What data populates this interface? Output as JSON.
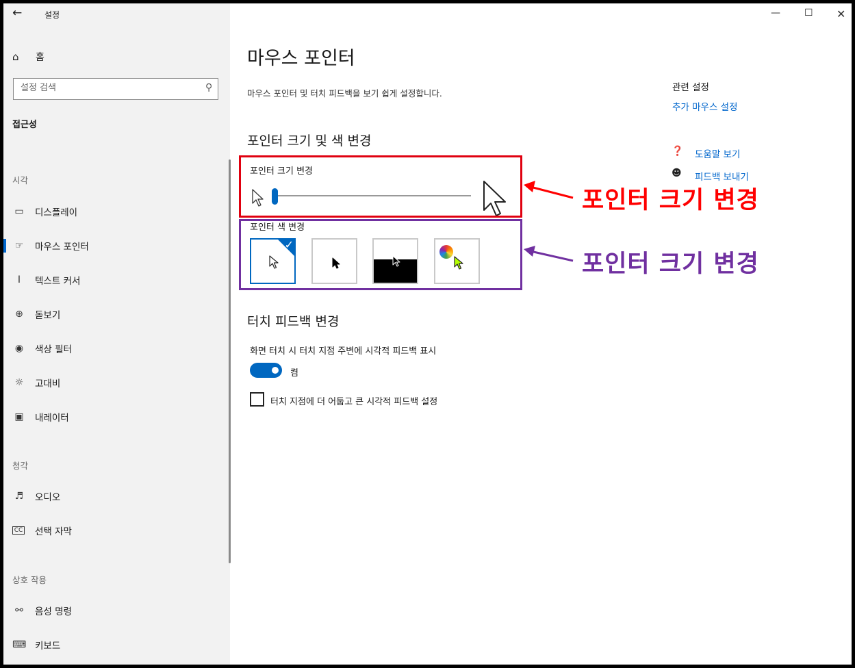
{
  "window": {
    "title": "설정",
    "back_icon": "back-arrow-icon"
  },
  "sidebar": {
    "home_label": "홈",
    "search_placeholder": "설정 검색",
    "section_title": "접근성",
    "categories": {
      "vision": "시각",
      "hearing": "청각",
      "interaction": "상호 작용"
    },
    "items": [
      {
        "label": "디스플레이",
        "icon": "display-icon"
      },
      {
        "label": "마우스 포인터",
        "icon": "mouse-pointer-icon",
        "active": true
      },
      {
        "label": "텍스트 커서",
        "icon": "text-cursor-icon"
      },
      {
        "label": "돋보기",
        "icon": "magnifier-icon"
      },
      {
        "label": "색상 필터",
        "icon": "palette-icon"
      },
      {
        "label": "고대비",
        "icon": "sun-icon"
      },
      {
        "label": "내레이터",
        "icon": "narrator-icon"
      },
      {
        "label": "오디오",
        "icon": "speaker-icon"
      },
      {
        "label": "선택 자막",
        "icon": "cc-icon"
      },
      {
        "label": "음성 명령",
        "icon": "microphone-icon"
      },
      {
        "label": "키보드",
        "icon": "keyboard-icon"
      }
    ]
  },
  "main": {
    "title": "마우스 포인터",
    "description": "마우스 포인터 및 터치 피드백을 보기 쉽게 설정합니다.",
    "section_pointer": "포인터 크기 및 색 변경",
    "size_label": "포인터 크기 변경",
    "size_slider_fraction": 0.02,
    "color_label": "포인터 색 변경",
    "color_options": [
      "white",
      "black",
      "inverted",
      "custom"
    ],
    "color_selected_index": 0,
    "section_touch": "터치 피드백 변경",
    "touch_label": "화면 터치 시 터치 지점 주변에 시각적 피드백 표시",
    "touch_toggle_state": "켬",
    "touch_toggle_on": true,
    "darker_feedback_label": "터치 지점에 더 어둡고 큰 시각적 피드백 설정",
    "darker_feedback_checked": false
  },
  "related": {
    "title": "관련 설정",
    "link_mouse": "추가 마우스 설정",
    "help_label": "도움말 보기",
    "feedback_label": "피드백 보내기"
  },
  "annotations": {
    "size_callout": "포인터 크기 변경",
    "color_callout": "포인터 크기 변경",
    "red_color": "#ff0000",
    "purple_color": "#7030a0"
  },
  "colors": {
    "accent": "#0067c0",
    "link": "#0066cc"
  }
}
